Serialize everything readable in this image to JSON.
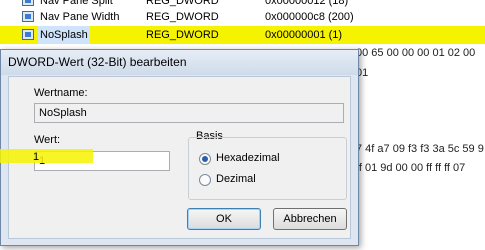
{
  "registry_rows": [
    {
      "name": "Nav Pane Split",
      "type": "REG_DWORD",
      "data": "0x00000012 (18)"
    },
    {
      "name": "Nav Pane Width",
      "type": "REG_DWORD",
      "data": "0x000000c8 (200)"
    },
    {
      "name": "NoSplash",
      "type": "REG_DWORD",
      "data": "0x00000001 (1)"
    }
  ],
  "hex_lines": [
    "00 65 00 00 00 01 02 00",
    "01",
    "7 4f a7 09 f3 f3 3a 5c 59 9",
    "ff 01 9d 00 00 ff ff ff 07"
  ],
  "dialog": {
    "title": "DWORD-Wert (32-Bit) bearbeiten",
    "name_label": "Wertname:",
    "name_value": "NoSplash",
    "value_label": "Wert:",
    "value_value": "1",
    "base_label": "Basis",
    "hex_label": "Hexadezimal",
    "dec_label": "Dezimal",
    "ok_label": "OK",
    "cancel_label": "Abbrechen",
    "base_selected": "Hexadezimal"
  },
  "colors": {
    "highlight": "#f6f300",
    "accent": "#2a5ea8"
  }
}
